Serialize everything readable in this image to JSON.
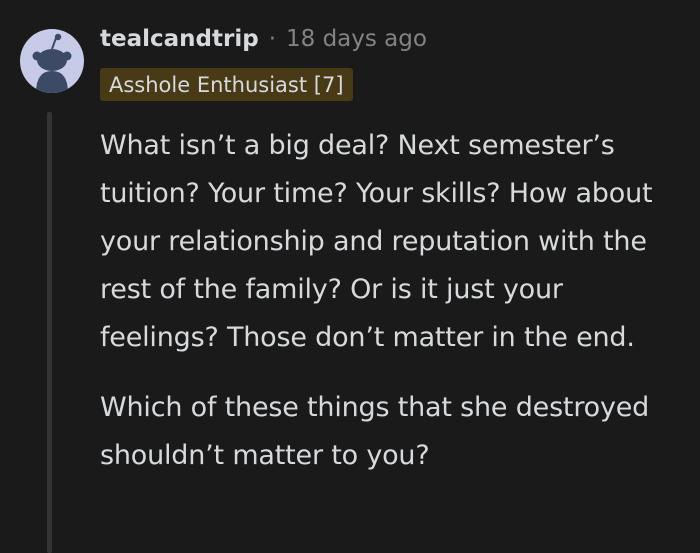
{
  "comment": {
    "author": "tealcandtrip",
    "separator": "·",
    "timestamp": "18 days ago",
    "flair": "Asshole Enthusiast [7]",
    "paragraphs": [
      "What isn’t a big deal? Next semester’s tuition? Your time? Your skills? How about your relationship and reputation with the rest of the family? Or is it just your feelings? Those don’t matter in the end.",
      "Which of these things that she destroyed shouldn’t matter to you?"
    ]
  },
  "icons": {
    "avatar": "snoo-avatar-icon"
  },
  "colors": {
    "background": "#1a1a1b",
    "text": "#d7dadc",
    "muted": "#818384",
    "flair_bg": "#483a16",
    "thread_line": "#343536",
    "avatar_bg": "#c7cbe8"
  }
}
